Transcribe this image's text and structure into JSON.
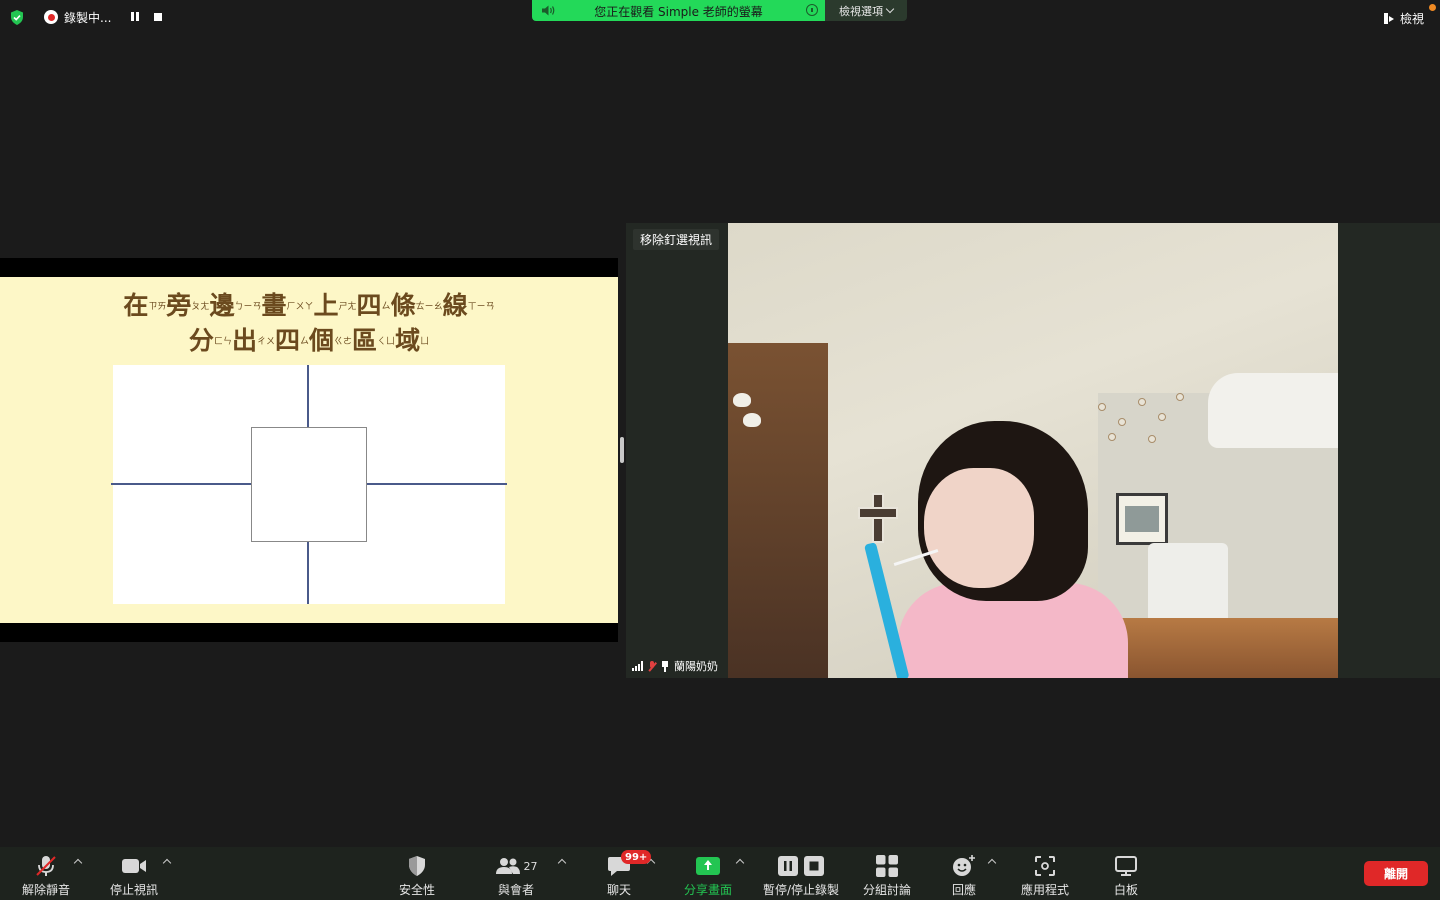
{
  "top_bar": {
    "recording_label": "錄製中...",
    "share_banner_text": "您正在觀看 Simple 老師的螢幕",
    "view_options_label": "檢視選項",
    "view_label": "檢視"
  },
  "slide": {
    "title_line1": [
      {
        "char": "在",
        "zhuyin": "ㄗㄞ"
      },
      {
        "char": "旁",
        "zhuyin": "ㄆㄤ"
      },
      {
        "char": "邊",
        "zhuyin": "ㄅㄧㄢ"
      },
      {
        "char": "畫",
        "zhuyin": "ㄏㄨㄚ"
      },
      {
        "char": "上",
        "zhuyin": "ㄕㄤ"
      },
      {
        "char": "四",
        "zhuyin": "ㄙ"
      },
      {
        "char": "條",
        "zhuyin": "ㄊㄧㄠ"
      },
      {
        "char": "線",
        "zhuyin": "ㄒㄧㄢ"
      }
    ],
    "title_line2": [
      {
        "char": "分",
        "zhuyin": "ㄈㄣ"
      },
      {
        "char": "出",
        "zhuyin": "ㄔㄨ"
      },
      {
        "char": "四",
        "zhuyin": "ㄙ"
      },
      {
        "char": "個",
        "zhuyin": "ㄍㄜ"
      },
      {
        "char": "區",
        "zhuyin": "ㄑㄩ"
      },
      {
        "char": "域",
        "zhuyin": "ㄩ"
      }
    ]
  },
  "video": {
    "unpin_label": "移除釘選視訊",
    "participant_name": "蘭陽奶奶"
  },
  "toolbar": {
    "unmute_label": "解除靜音",
    "stop_video_label": "停止視訊",
    "security_label": "安全性",
    "participants_label": "與會者",
    "participants_count": "27",
    "chat_label": "聊天",
    "chat_badge": "99+",
    "share_label": "分享畫面",
    "pause_record_label": "暫停/停止錄製",
    "breakout_label": "分組討論",
    "reactions_label": "回應",
    "apps_label": "應用程式",
    "whiteboard_label": "白板",
    "leave_label": "離開"
  },
  "colors": {
    "banner_green": "#23d959",
    "leave_red": "#e02828",
    "share_green": "#23c552",
    "slide_bg": "#fdf7c7",
    "title_brown": "#6b4a1e"
  }
}
